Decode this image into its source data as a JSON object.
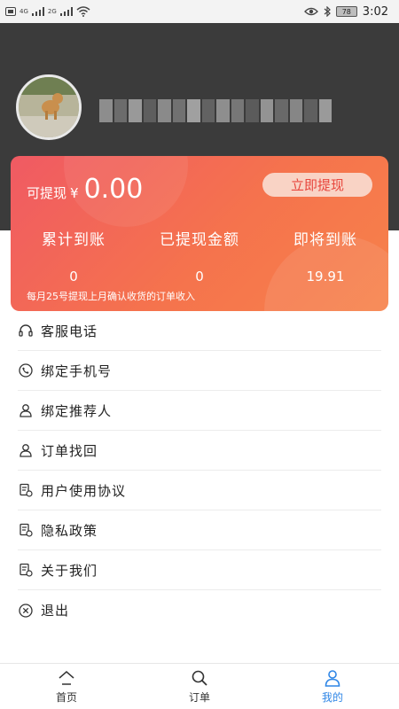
{
  "status_bar": {
    "network_1": "4G",
    "network_2": "2G",
    "battery": "78",
    "time": "3:02"
  },
  "profile": {
    "avatar_icon": "dog-photo-avatar"
  },
  "earnings": {
    "withdrawable_label": "可提现",
    "currency": "¥",
    "withdrawable_amount": "0.00",
    "withdraw_button": "立即提现",
    "stats": [
      {
        "label": "累计到账",
        "value": "0"
      },
      {
        "label": "已提现金额",
        "value": "0"
      },
      {
        "label": "即将到账",
        "value": "19.91"
      }
    ],
    "note": "每月25号提现上月确认收货的订单收入",
    "gradient_start": "#f05a63",
    "gradient_end": "#f7824a"
  },
  "menu": [
    {
      "label": "客服电话",
      "icon": "headset-icon"
    },
    {
      "label": "绑定手机号",
      "icon": "phone-icon"
    },
    {
      "label": "绑定推荐人",
      "icon": "person-icon"
    },
    {
      "label": "订单找回",
      "icon": "person-icon"
    },
    {
      "label": "用户使用协议",
      "icon": "document-icon"
    },
    {
      "label": "隐私政策",
      "icon": "document-icon"
    },
    {
      "label": "关于我们",
      "icon": "document-icon"
    },
    {
      "label": "退出",
      "icon": "close-circle-icon"
    }
  ],
  "bottom_nav": [
    {
      "label": "首页",
      "icon": "home-icon",
      "active": false
    },
    {
      "label": "订单",
      "icon": "search-icon",
      "active": false
    },
    {
      "label": "我的",
      "icon": "user-icon",
      "active": true
    }
  ],
  "colors": {
    "header_bg": "#3b3b3b",
    "accent": "#2f86e6",
    "button_text": "#e8453c"
  }
}
